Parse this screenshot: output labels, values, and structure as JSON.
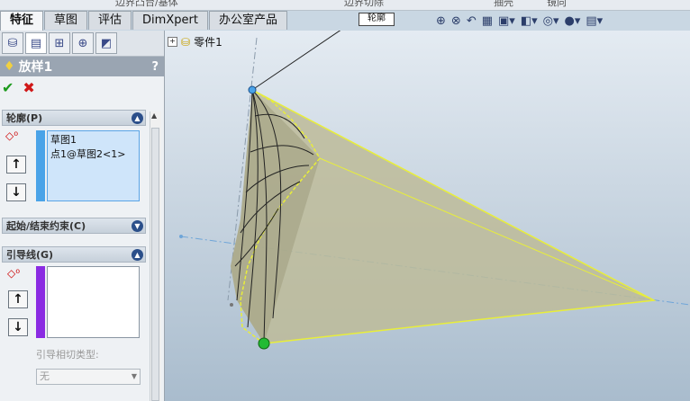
{
  "top_strip": {
    "item1": "边界凸台/基体",
    "item2": "边界切除",
    "item3": "抽壳",
    "item4": "镜向"
  },
  "tabs": [
    {
      "label": "特征"
    },
    {
      "label": "草图"
    },
    {
      "label": "评估"
    },
    {
      "label": "DimXpert"
    },
    {
      "label": "办公室产品"
    }
  ],
  "feature": {
    "title": "放样1",
    "help": "?"
  },
  "profile_group": {
    "label": "轮廓(P)",
    "items": [
      "草图1",
      "点1@草图2<1>"
    ]
  },
  "constraint_group": {
    "label": "起始/结束约束(C)"
  },
  "guide_group": {
    "label": "引导线(G)",
    "tangency_label": "引导相切类型:",
    "tangency_value": "无"
  },
  "tree": {
    "part_label": "零件1"
  },
  "tooltip": {
    "text": "轮廓"
  },
  "colors": {
    "profile_bar": "#4aa3e8",
    "guide_bar": "#8a2be2",
    "shape_fill": "#bdbb99",
    "shape_edge": "#e8ee3a"
  },
  "icons": {
    "ok": "checkmark-icon",
    "cancel": "x-icon",
    "up": "arrow-up-icon",
    "down": "arrow-down-icon"
  }
}
